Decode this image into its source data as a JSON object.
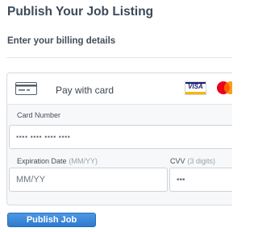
{
  "page": {
    "title": "Publish Your Job Listing",
    "subtitle": "Enter your billing details"
  },
  "payment": {
    "method_label": "Pay with card",
    "method_icon": "credit-card-icon",
    "brands": [
      {
        "name": "VISA",
        "icon": "visa-icon",
        "color": "#1a1f71"
      },
      {
        "name": "Mastercard",
        "icon": "mastercard-icon",
        "colors": [
          "#eb001b",
          "#f79e1b"
        ]
      }
    ]
  },
  "form": {
    "card_number": {
      "label": "Card Number",
      "placeholder": "•••• •••• •••• ••••"
    },
    "expiration": {
      "label": "Expiration Date",
      "hint": "(MM/YY)",
      "placeholder": "MM/YY"
    },
    "cvv": {
      "label": "CVV",
      "hint": "(3 digits)",
      "placeholder": "•••"
    }
  },
  "actions": {
    "publish_label": "Publish Job",
    "accent_color": "#3b86d8"
  }
}
